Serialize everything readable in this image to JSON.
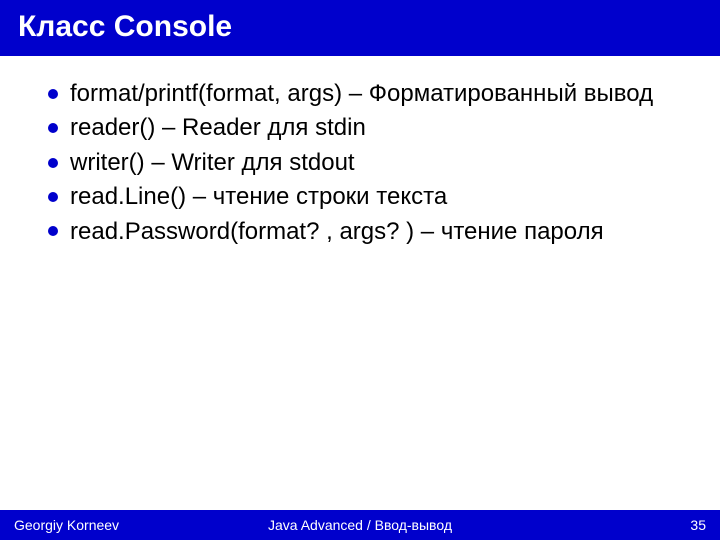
{
  "title": "Класс Console",
  "bullets": [
    "format/printf(format, args) – Форматированный вывод",
    "reader() – Reader для stdin",
    "writer() – Writer для stdout",
    "read.Line() – чтение строки текста",
    "read.Password(format? , args? ) – чтение пароля"
  ],
  "footer": {
    "left": "Georgiy Korneev",
    "center": "Java Advanced / Ввод-вывод",
    "right": "35"
  }
}
